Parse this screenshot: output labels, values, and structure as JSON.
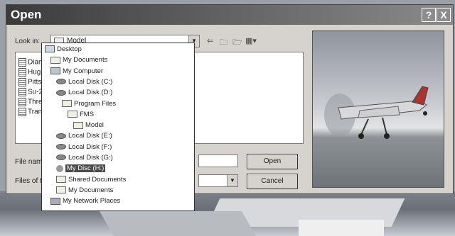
{
  "window": {
    "title": "Open",
    "help": "?",
    "close": "X"
  },
  "lookin": {
    "label": "Look in:",
    "value": "Model"
  },
  "files": [
    "Diam",
    "Hugh",
    "Pitts",
    "Su-2",
    "Thre",
    "Trans"
  ],
  "dropdown": [
    {
      "label": "Desktop",
      "icon": "desktop-icon",
      "level": 0
    },
    {
      "label": "My Documents",
      "icon": "folder-icon",
      "level": 1
    },
    {
      "label": "My Computer",
      "icon": "computer-icon",
      "level": 1
    },
    {
      "label": "Local Disk (C:)",
      "icon": "disk-icon",
      "level": 2
    },
    {
      "label": "Local Disk (D:)",
      "icon": "disk-icon",
      "level": 2
    },
    {
      "label": "Program Files",
      "icon": "folder-icon",
      "level": 3
    },
    {
      "label": "FMS",
      "icon": "folder-icon",
      "level": 4
    },
    {
      "label": "Model",
      "icon": "folder-icon",
      "level": 5
    },
    {
      "label": "Local Disk (E:)",
      "icon": "disk-icon",
      "level": 2
    },
    {
      "label": "Local Disk (F:)",
      "icon": "disk-icon",
      "level": 2
    },
    {
      "label": "Local Disk (G:)",
      "icon": "disk-icon",
      "level": 2
    },
    {
      "label": "My Disc (H:)",
      "icon": "cd-icon",
      "level": 2,
      "selected": true
    },
    {
      "label": "Shared Documents",
      "icon": "folder-icon",
      "level": 2
    },
    {
      "label": "My Documents",
      "icon": "folder-icon",
      "level": 2
    },
    {
      "label": "My Network Places",
      "icon": "network-icon",
      "level": 1
    }
  ],
  "filename": {
    "label": "File name:",
    "value": ""
  },
  "filetype": {
    "label": "Files of type:",
    "value": ""
  },
  "buttons": {
    "open": "Open",
    "cancel": "Cancel"
  }
}
